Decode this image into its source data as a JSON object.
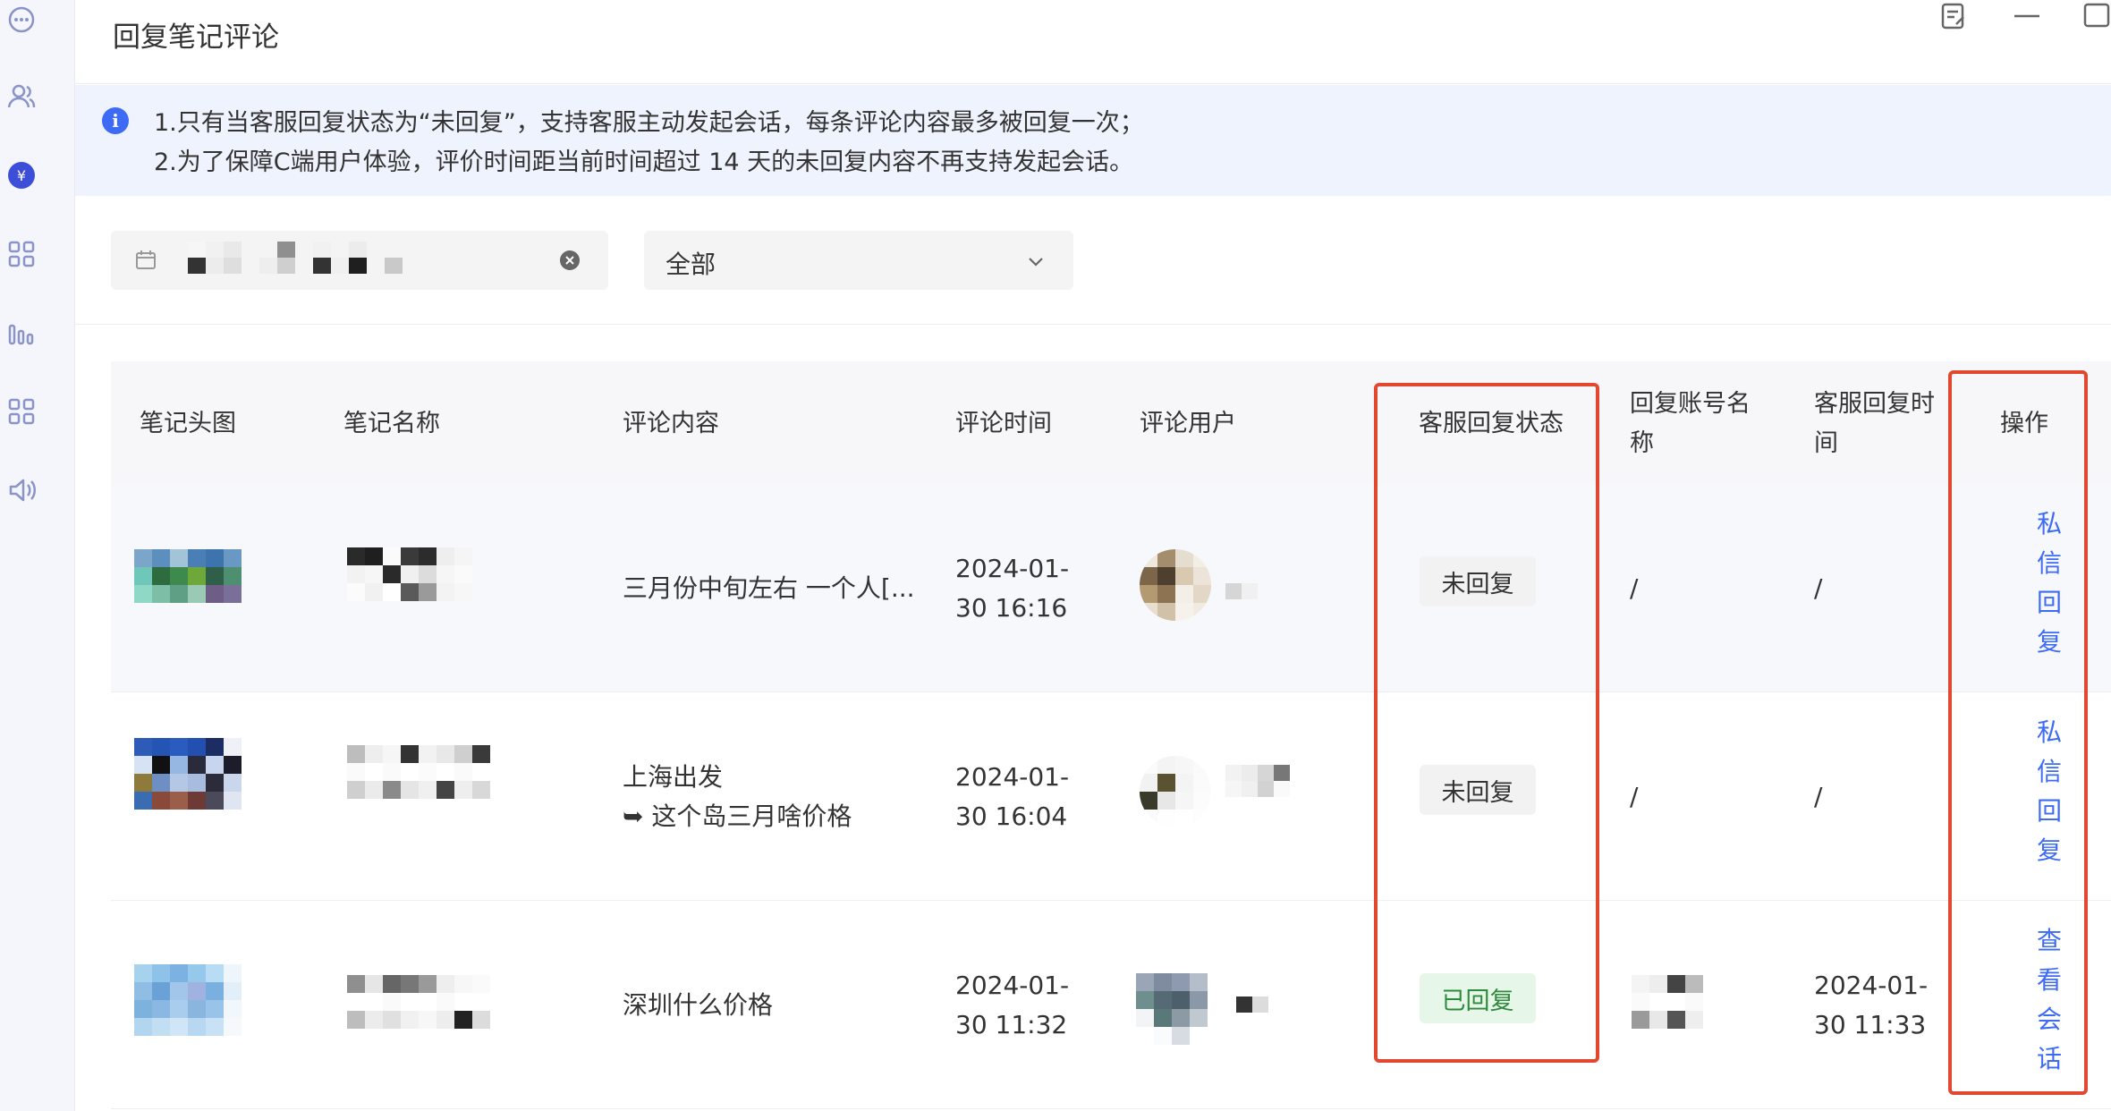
{
  "page": {
    "title": "回复笔记评论"
  },
  "sidebar": {
    "icons": [
      "chat-icon",
      "users-icon",
      "money-icon",
      "apps-icon",
      "chart-icon",
      "grid-icon",
      "speaker-icon"
    ]
  },
  "notice": {
    "line1": "1.只有当客服回复状态为“未回复”，支持客服主动发起会话，每条评论内容最多被回复一次；",
    "line2": "2.为了保障C端用户体验，评价时间距当前时间超过 14 天的未回复内容不再支持发起会话。"
  },
  "filters": {
    "status_select": "全部"
  },
  "table": {
    "headers": {
      "cover": "笔记头图",
      "note_name": "笔记名称",
      "comment": "评论内容",
      "comment_time": "评论时间",
      "user": "评论用户",
      "status": "客服回复状态",
      "reply_account_l1": "回复账号名",
      "reply_account_l2": "称",
      "reply_time_l1": "客服回复时",
      "reply_time_l2": "间",
      "action": "操作"
    },
    "rows": [
      {
        "comment_l1": "三月份中旬左右 一个人[...",
        "comment_l2": "",
        "time_l1": "2024-01-",
        "time_l2": "30 16:16",
        "status": "未回复",
        "reply_account": "/",
        "reply_time_l1": "/",
        "reply_time_l2": "",
        "action": "私信回复"
      },
      {
        "comment_l1": "上海出发",
        "comment_l2": "➥ 这个岛三月啥价格",
        "time_l1": "2024-01-",
        "time_l2": "30 16:04",
        "status": "未回复",
        "reply_account": "/",
        "reply_time_l1": "/",
        "reply_time_l2": "",
        "action": "私信回复"
      },
      {
        "comment_l1": "深圳什么价格",
        "comment_l2": "",
        "time_l1": "2024-01-",
        "time_l2": "30 11:32",
        "status": "已回复",
        "reply_account": "",
        "reply_time_l1": "2024-01-",
        "reply_time_l2": "30 11:33",
        "action": "查看会话"
      }
    ]
  },
  "colors": {
    "accent": "#3d6bf5",
    "highlight": "#e2472f",
    "done": "#2e8b3c"
  }
}
